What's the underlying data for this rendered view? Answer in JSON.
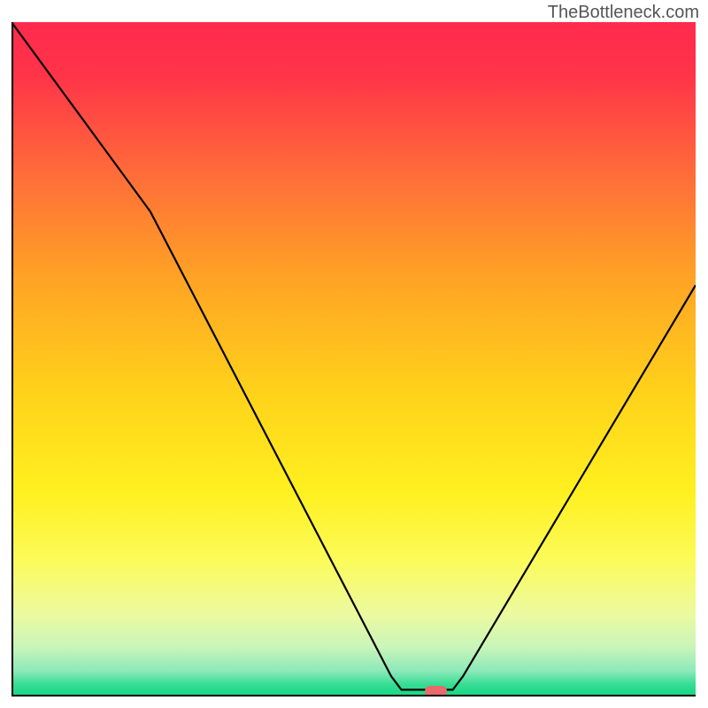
{
  "watermark": "TheBottleneck.com",
  "chart_data": {
    "type": "line",
    "title": "",
    "xlabel": "",
    "ylabel": "",
    "x_range": [
      0,
      100
    ],
    "y_range": [
      0,
      100
    ],
    "series": [
      {
        "name": "curve",
        "points": [
          {
            "x": 0.0,
            "y": 100.0
          },
          {
            "x": 20.3,
            "y": 71.9
          },
          {
            "x": 55.5,
            "y": 3.0
          },
          {
            "x": 57.0,
            "y": 1.0
          },
          {
            "x": 64.5,
            "y": 1.0
          },
          {
            "x": 66.0,
            "y": 3.0
          },
          {
            "x": 100.0,
            "y": 61.0
          }
        ]
      }
    ],
    "marker": {
      "x": 62.0,
      "y": 0.8,
      "w_pct": 3.2,
      "h_pct": 1.5
    },
    "gradient_stops": [
      {
        "offset": 0,
        "color": "#ff2a4d"
      },
      {
        "offset": 0.08,
        "color": "#ff3448"
      },
      {
        "offset": 0.22,
        "color": "#ff6a3a"
      },
      {
        "offset": 0.38,
        "color": "#ffa325"
      },
      {
        "offset": 0.55,
        "color": "#ffd21a"
      },
      {
        "offset": 0.7,
        "color": "#fff020"
      },
      {
        "offset": 0.8,
        "color": "#fbfb5a"
      },
      {
        "offset": 0.88,
        "color": "#ecfaa0"
      },
      {
        "offset": 0.93,
        "color": "#c8f5b9"
      },
      {
        "offset": 0.965,
        "color": "#8be9b9"
      },
      {
        "offset": 0.985,
        "color": "#35dd93"
      },
      {
        "offset": 1.0,
        "color": "#17d884"
      }
    ]
  }
}
